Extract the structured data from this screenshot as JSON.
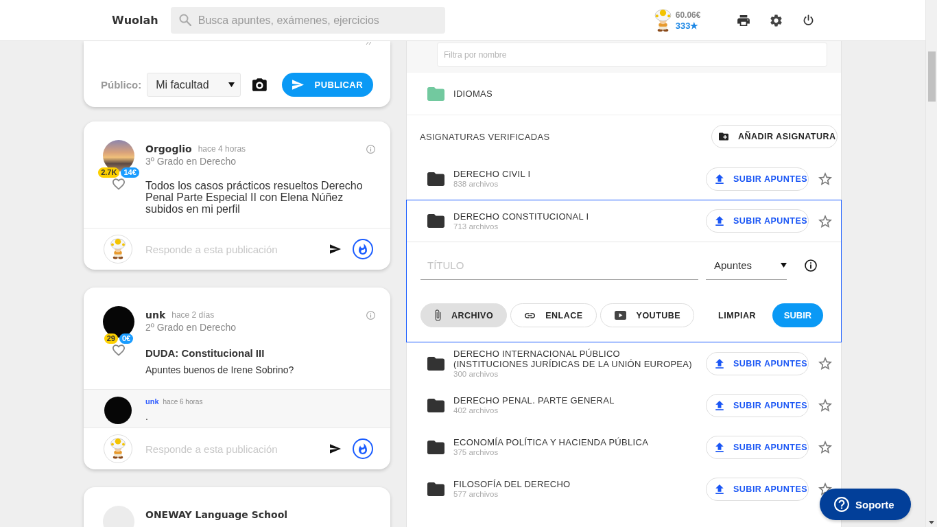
{
  "header": {
    "logo": "Wuolah",
    "search": {
      "placeholder": "Busca apuntes, exámenes, ejercicios"
    },
    "user": {
      "balance": "60.06€",
      "points": "333★"
    }
  },
  "composer": {
    "audience_label": "Público:",
    "audience": "Mi facultad",
    "publish_button": "PUBLICAR"
  },
  "posts": [
    {
      "kind": "post",
      "author": "Orgoglio",
      "time": "hace 4 horas",
      "course": "3º Grado en Derecho",
      "avatar": {
        "kind": "photo"
      },
      "points": "2.7K",
      "money": "14€",
      "liked": false,
      "text": "Todos los casos prácticos resueltos Derecho Penal Parte Especial II con Elena Núñez subidos en mi perfil",
      "reply_placeholder": "Responde a esta publicación"
    },
    {
      "kind": "post",
      "author": "unk",
      "time": "hace 2 días",
      "course": "2º Grado en Derecho",
      "avatar": {
        "kind": "dark"
      },
      "points": "29",
      "money": "0€",
      "liked": false,
      "title": "DUDA: Constitucional III",
      "text": "Apuntes buenos de Irene Sobrino?",
      "comments": [
        {
          "author": "unk",
          "time": "hace 6 horas",
          "avatar": {
            "kind": "dark"
          },
          "text": "."
        }
      ],
      "reply_placeholder": "Responde a esta publicación"
    },
    {
      "kind": "promo",
      "author": "ONEWAY Language School",
      "avatar": {
        "kind": "blank"
      }
    }
  ],
  "subjects_panel": {
    "filter": {
      "placeholder": "Filtra por nombre"
    },
    "folders": [
      {
        "name": "IDIOMAS"
      }
    ],
    "section_title": "ASIGNATURAS VERIFICADAS",
    "add_button": "AÑADIR ASIGNATURA",
    "subjects": [
      {
        "name": "DERECHO CIVIL I",
        "count": "838 archivos",
        "upload_button": "SUBIR APUNTES",
        "starred": false,
        "expanded": false
      },
      {
        "name": "DERECHO CONSTITUCIONAL I",
        "count": "713 archivos",
        "upload_button": "SUBIR APUNTES",
        "starred": false,
        "expanded": true
      },
      {
        "name": "DERECHO INTERNACIONAL PÚBLICO (INSTITUCIONES JURÍDICAS DE LA UNIÓN EUROPEA)",
        "count": "300 archivos",
        "upload_button": "SUBIR APUNTES",
        "starred": false,
        "expanded": false
      },
      {
        "name": "DERECHO PENAL. PARTE GENERAL",
        "count": "402 archivos",
        "upload_button": "SUBIR APUNTES",
        "starred": false,
        "expanded": false
      },
      {
        "name": "ECONOMÍA POLÍTICA Y HACIENDA PÚBLICA",
        "count": "375 archivos",
        "upload_button": "SUBIR APUNTES",
        "starred": false,
        "expanded": false
      },
      {
        "name": "FILOSOFÍA DEL DERECHO",
        "count": "577 archivos",
        "upload_button": "SUBIR APUNTES",
        "starred": false,
        "expanded": false
      }
    ],
    "upload_form": {
      "title_placeholder": "TÍTULO",
      "type": "Apuntes",
      "sources": [
        {
          "kind": "file",
          "label": "ARCHIVO",
          "selected": true
        },
        {
          "kind": "link",
          "label": "ENLACE",
          "selected": false
        },
        {
          "kind": "video",
          "label": "YOUTUBE",
          "selected": false
        }
      ],
      "clear_button": "LIMPIAR",
      "submit_button": "SUBIR"
    }
  },
  "support_button": "Soporte"
}
